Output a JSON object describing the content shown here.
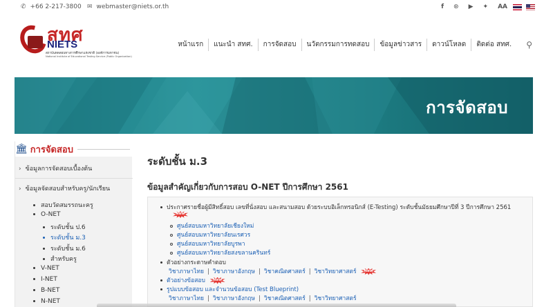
{
  "topbar": {
    "phone": "+66 2-217-3800",
    "email": "webmaster@niets.or.th",
    "icons": [
      "facebook-icon",
      "rss-icon",
      "youtube-icon",
      "twitter-icon"
    ],
    "font_size_label": "AA"
  },
  "logo": {
    "thai": "สทศ",
    "english": "NIETS",
    "line1": "สถาบันทดสอบทางการศึกษาแห่งชาติ (องค์การมหาชน)",
    "line2": "National Institute of Educational Testing Service (Public Organization)"
  },
  "nav": {
    "items": [
      "หน้าแรก",
      "แนะนำ สทศ.",
      "การจัดสอบ",
      "นวัตกรรมการทดสอบ",
      "ข้อมูลข่าวสาร",
      "ดาวน์โหลด",
      "ติดต่อ สทศ."
    ]
  },
  "banner": {
    "title": "การจัดสอบ"
  },
  "sidebar": {
    "title": "การจัดสอบ",
    "sections": [
      "ข้อมูลการจัดสอบเบื้องต้น",
      "ข้อมูลจัดสอบสำหรับครู/นักเรียน"
    ],
    "items": [
      {
        "label": "สอบวัดสมรรถนะครู"
      },
      {
        "label": "O-NET"
      },
      {
        "label": "ระดับชั้น ป.6"
      },
      {
        "label": "ระดับชั้น ม.3"
      },
      {
        "label": "ระดับชั้น ม.6"
      },
      {
        "label": "สำหรับครู"
      },
      {
        "label": "V-NET"
      },
      {
        "label": "I-NET"
      },
      {
        "label": "B-NET"
      },
      {
        "label": "N-NET"
      }
    ]
  },
  "main": {
    "title": "ระดับชั้น ม.3",
    "subtitle": "ข้อมูลสำคัญเกี่ยวกับการสอบ O-NET ปีการศึกษา 2561",
    "announcement": "ประกาศรายชื่อผู้มีสิทธิ์สอบ เลขที่นั่งสอบ และสนามสอบ ด้วยระบบอิเล็กทรอนิกส์ (E-Testing) ระดับชั้นมัธยมศึกษาปีที่ 3 ปีการศึกษา 2561",
    "new_label": "New",
    "centers": [
      "ศูนย์สอบมหาวิทยาลัยเชียงใหม่",
      "ศูนย์สอบมหาวิทยาลัยนเรศวร",
      "ศูนย์สอบมหาวิทยาลัยบูรพา",
      "ศูนย์สอบมหาวิทยาลัยสงขลานครินทร์"
    ],
    "examples_label": "ตัวอย่างกระดาษคำตอบ",
    "subjects": [
      "วิชาภาษาไทย",
      "วิชาภาษาอังกฤษ",
      "วิชาคณิตศาสตร์",
      "วิชาวิทยาศาสตร์"
    ],
    "sample_tests_label": "ตัวอย่างข้อสอบ",
    "blueprint_label": "รูปแบบข้อสอบ และจำนวนข้อสอบ (Test Blueprint)",
    "blueprint_subjects": [
      "วิชาภาษาไทย",
      "วิชาภาษาอังกฤษ",
      "วิชาคณิตศาสตร์",
      "วิชาวิทยาศาสตร์"
    ]
  }
}
